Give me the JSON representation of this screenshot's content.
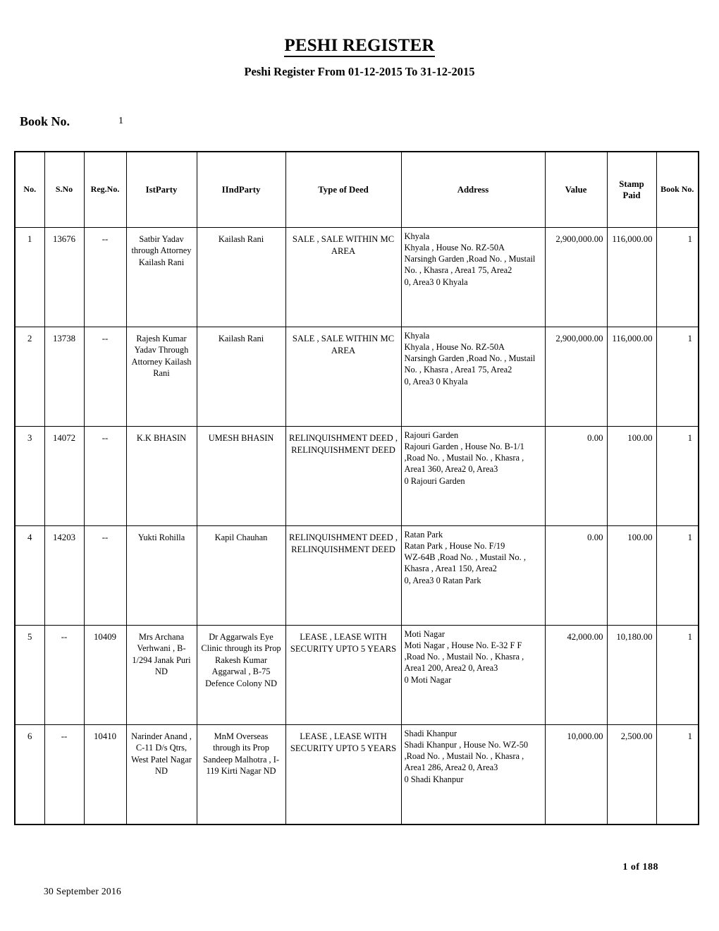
{
  "document": {
    "title": "PESHI REGISTER",
    "subtitle": "Peshi Register From 01-12-2015 To 31-12-2015",
    "book_no_label": "Book No.",
    "book_no_value": "1"
  },
  "table": {
    "headers": {
      "no": "No.",
      "sno": "S.No",
      "regno": "Reg.No.",
      "ist_party": "IstParty",
      "iind_party": "IIndParty",
      "type_of_deed": "Type of Deed",
      "address": "Address",
      "value": "Value",
      "stamp_paid": "Stamp\nPaid",
      "stamp_paid_line1": "Stamp",
      "stamp_paid_line2": "Paid",
      "book_no": "Book No."
    },
    "rows": [
      {
        "no": "1",
        "sno": "13676",
        "regno": "--",
        "ist_party": "Satbir Yadav through Attorney Kailash Rani",
        "iind_party": "Kailash Rani",
        "type_of_deed": "SALE , SALE WITHIN MC AREA",
        "address": "Khyala\nKhyala   , House No. RZ-50A\nNarsingh Garden ,Road No. , Mustail\nNo. , Khasra , Area1        75, Area2\n0, Area3        0  Khyala",
        "value": "2,900,000.00",
        "stamp_paid": "116,000.00",
        "book_no": "1"
      },
      {
        "no": "2",
        "sno": "13738",
        "regno": "--",
        "ist_party": "Rajesh  Kumar Yadav  Through Attorney Kailash Rani",
        "iind_party": "Kailash Rani",
        "type_of_deed": "SALE , SALE WITHIN MC AREA",
        "address": "Khyala\nKhyala   , House No. RZ-50A\nNarsingh  Garden ,Road No. , Mustail\nNo. , Khasra , Area1        75, Area2\n0, Area3        0  Khyala",
        "value": "2,900,000.00",
        "stamp_paid": "116,000.00",
        "book_no": "1"
      },
      {
        "no": "3",
        "sno": "14072",
        "regno": "--",
        "ist_party": "K.K BHASIN",
        "iind_party": "UMESH BHASIN",
        "type_of_deed": "RELINQUISHMENT DEED , RELINQUISHMENT DEED",
        "address": "Rajouri Garden\nRajouri Garden     , House No. B-1/1\n,Road No. , Mustail No. , Khasra ,\nArea1        360, Area2        0, Area3\n0  Rajouri Garden",
        "value": "0.00",
        "stamp_paid": "100.00",
        "book_no": "1"
      },
      {
        "no": "4",
        "sno": "14203",
        "regno": "--",
        "ist_party": "Yukti Rohilla",
        "iind_party": "Kapil Chauhan",
        "type_of_deed": "RELINQUISHMENT DEED , RELINQUISHMENT DEED",
        "address": "Ratan Park\nRatan Park   , House No. F/19\nWZ-64B ,Road No. , Mustail No. ,\nKhasra , Area1        150, Area2\n0, Area3        0  Ratan Park",
        "value": "0.00",
        "stamp_paid": "100.00",
        "book_no": "1"
      },
      {
        "no": "5",
        "sno": "--",
        "regno": "10409",
        "ist_party": "Mrs Archana Verhwani , B-1/294 Janak Puri ND",
        "iind_party": "Dr Aggarwals Eye Clinic through its Prop Rakesh Kumar Aggarwal , B-75 Defence Colony ND",
        "type_of_deed": "LEASE , LEASE WITH SECURITY UPTO 5 YEARS",
        "address": "Moti Nagar\nMoti Nagar   , House No. E-32 F F\n,Road No. , Mustail No. , Khasra ,\nArea1        200, Area2        0, Area3\n0  Moti Nagar",
        "value": "42,000.00",
        "stamp_paid": "10,180.00",
        "book_no": "1"
      },
      {
        "no": "6",
        "sno": "--",
        "regno": "10410",
        "ist_party": "Narinder Anand , C-11 D/s Qtrs, West Patel Nagar ND",
        "iind_party": "MnM Overseas through its Prop Sandeep Malhotra , I-119 Kirti Nagar ND",
        "type_of_deed": "LEASE , LEASE WITH SECURITY UPTO 5 YEARS",
        "address": "Shadi Khanpur\nShadi Khanpur , House No. WZ-50\n,Road No. , Mustail No. , Khasra ,\nArea1        286, Area2        0, Area3\n0  Shadi Khanpur",
        "value": "10,000.00",
        "stamp_paid": "2,500.00",
        "book_no": "1"
      }
    ]
  },
  "footer": {
    "page_indicator": "1  of  188",
    "date": "30  September  2016"
  }
}
